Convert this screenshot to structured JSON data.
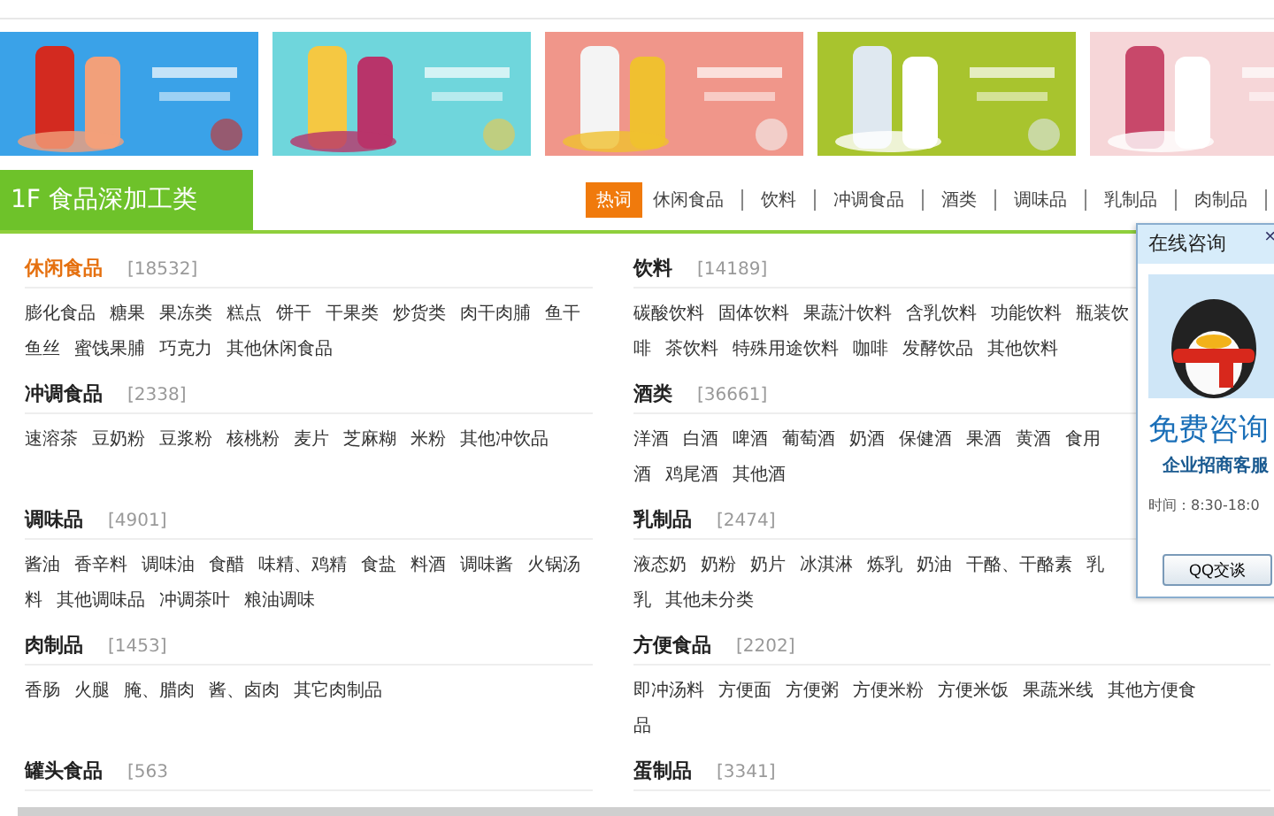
{
  "floor": {
    "title": "1F 食品深加工类",
    "nav": [
      {
        "label": "热词",
        "selected": true
      },
      {
        "label": "休闲食品",
        "selected": false
      },
      {
        "label": "饮料",
        "selected": false
      },
      {
        "label": "冲调食品",
        "selected": false
      },
      {
        "label": "酒类",
        "selected": false
      },
      {
        "label": "调味品",
        "selected": false
      },
      {
        "label": "乳制品",
        "selected": false
      },
      {
        "label": "肉制品",
        "selected": false
      }
    ],
    "categories": [
      {
        "name": "休闲食品",
        "count": "[18532]",
        "selected": true,
        "lines": [
          [
            "膨化食品",
            "糖果",
            "果冻类",
            "糕点",
            "饼干",
            "干果类",
            "炒货类",
            "肉干肉脯",
            "鱼干"
          ],
          [
            "鱼丝",
            "蜜饯果脯",
            "巧克力",
            "其他休闲食品"
          ]
        ]
      },
      {
        "name": "饮料",
        "count": "[14189]",
        "selected": false,
        "lines": [
          [
            "碳酸饮料",
            "固体饮料",
            "果蔬汁饮料",
            "含乳饮料",
            "功能饮料",
            "瓶装饮"
          ],
          [
            "啡",
            "茶饮料",
            "特殊用途饮料",
            "咖啡",
            "发酵饮品",
            "其他饮料"
          ]
        ]
      },
      {
        "name": "冲调食品",
        "count": "[2338]",
        "selected": false,
        "lines": [
          [
            "速溶茶",
            "豆奶粉",
            "豆浆粉",
            "核桃粉",
            "麦片",
            "芝麻糊",
            "米粉",
            "其他冲饮品"
          ]
        ]
      },
      {
        "name": "酒类",
        "count": "[36661]",
        "selected": false,
        "lines": [
          [
            "洋酒",
            "白酒",
            "啤酒",
            "葡萄酒",
            "奶酒",
            "保健酒",
            "果酒",
            "黄酒",
            "食用"
          ],
          [
            "酒",
            "鸡尾酒",
            "其他酒"
          ]
        ]
      },
      {
        "name": "调味品",
        "count": "[4901]",
        "selected": false,
        "lines": [
          [
            "酱油",
            "香辛料",
            "调味油",
            "食醋",
            "味精、鸡精",
            "食盐",
            "料酒",
            "调味酱",
            "火锅汤"
          ],
          [
            "料",
            "其他调味品",
            "冲调茶叶",
            "粮油调味"
          ]
        ]
      },
      {
        "name": "乳制品",
        "count": "[2474]",
        "selected": false,
        "lines": [
          [
            "液态奶",
            "奶粉",
            "奶片",
            "冰淇淋",
            "炼乳",
            "奶油",
            "干酪、干酪素",
            "乳"
          ],
          [
            "乳",
            "其他未分类"
          ]
        ]
      },
      {
        "name": "肉制品",
        "count": "[1453]",
        "selected": false,
        "lines": [
          [
            "香肠",
            "火腿",
            "腌、腊肉",
            "酱、卤肉",
            "其它肉制品"
          ]
        ]
      },
      {
        "name": "方便食品",
        "count": "[2202]",
        "selected": false,
        "lines": [
          [
            "即冲汤料",
            "方便面",
            "方便粥",
            "方便米粉",
            "方便米饭",
            "果蔬米线",
            "其他方便食"
          ],
          [
            "品"
          ]
        ]
      },
      {
        "name": "罐头食品",
        "count": "[563",
        "selected": false
      },
      {
        "name": "蛋制品",
        "count": "[3341]",
        "selected": false
      }
    ]
  },
  "chat": {
    "title": "在线咨询",
    "close": "×",
    "headline": "免费咨询",
    "subtitle": "企业招商客服",
    "hours": "时间：8:30-18:0",
    "button": "QQ交谈"
  }
}
